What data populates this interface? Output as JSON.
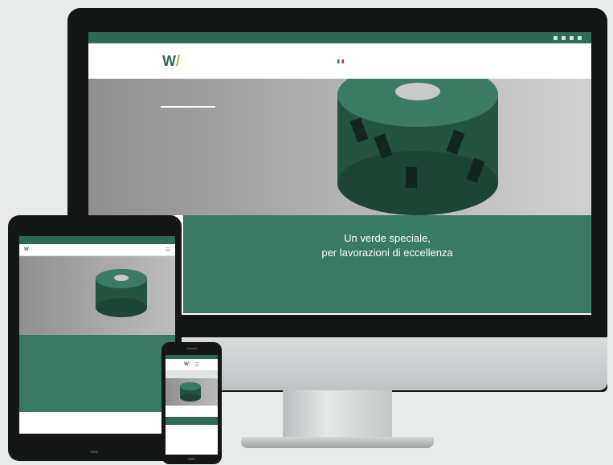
{
  "colors": {
    "brand_green": "#3a7a64",
    "brand_dark_green": "#2e6a55",
    "accent_lime": "#8cbf3f"
  },
  "desktop": {
    "topbar": {
      "phone": "",
      "email": ""
    },
    "logo": {
      "mark": "W",
      "name": "",
      "sub": ""
    },
    "nav": {
      "items": [
        "",
        "",
        "",
        "",
        "",
        "",
        ""
      ]
    },
    "hero": {
      "text": ""
    },
    "band": {
      "title_line1": "Un verde speciale,",
      "title_line2": "per lavorazioni di eccellenza",
      "body": ""
    }
  },
  "tablet": {
    "hero_text": "",
    "band": {
      "title_line1": "",
      "title_line2": "",
      "title_line3": "",
      "body": ""
    },
    "footer": [
      "",
      "",
      ""
    ]
  },
  "phone": {
    "logo": {
      "mark": "W"
    },
    "text": ""
  },
  "icons": [
    "social-facebook-icon",
    "social-linkedin-icon",
    "social-youtube-icon",
    "social-instagram-icon",
    "flag-it-icon",
    "hamburger-menu-icon"
  ]
}
